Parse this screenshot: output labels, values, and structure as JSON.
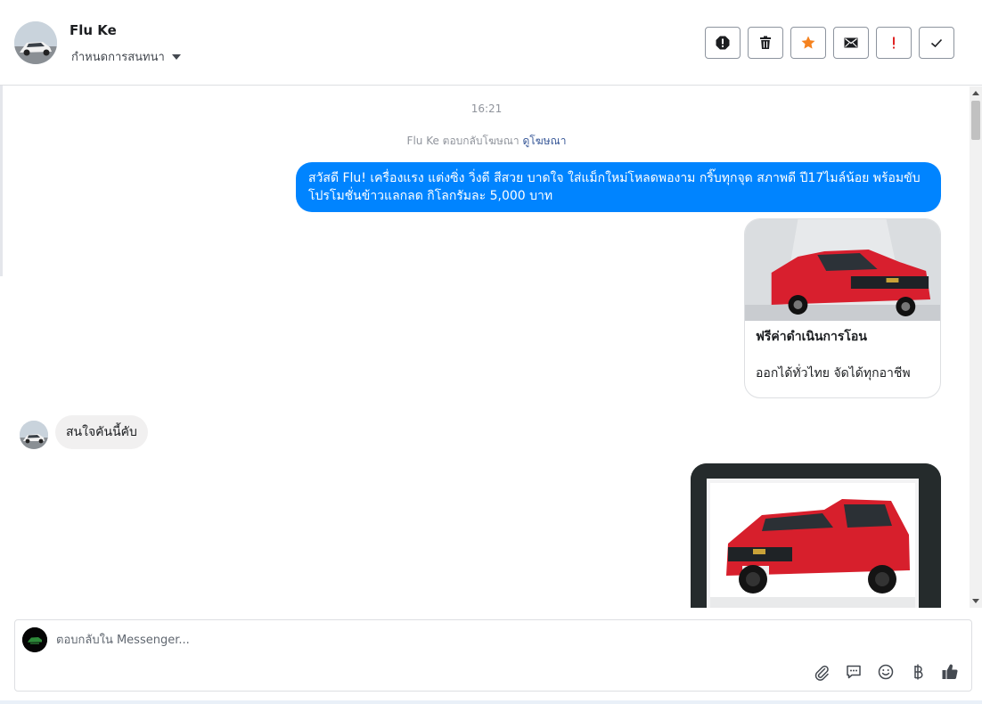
{
  "header": {
    "contact_name": "Flu Ke",
    "assign_label": "กำหนดการสนทนา"
  },
  "toolbar": {
    "buttons": [
      "spam-icon",
      "trash-icon",
      "star-icon",
      "mail-icon",
      "important-icon",
      "check-icon"
    ],
    "accent_colors": {
      "star": "#f5821f",
      "important": "#e02424"
    }
  },
  "conversation": {
    "timestamp": "16:21",
    "ad_reply_text": "Flu Ke ตอบกลับโฆษณา",
    "ad_reply_link": "ดูโฆษณา",
    "outgoing_message": "สวัสดี Flu! เครื่องแรง แต่งซิ่ง วิ่งดี สีสวย บาดใจ ใส่แม็กใหม่โหลดพองาม กริ๊บทุกจุด สภาพดี ปี17ไมล์น้อย พร้อมขับ โปรโมชั่นข้าวแลกลด กิโลกรัมละ 5,000 บาท",
    "card_title": "ฟรีค่าดำเนินการโอน",
    "card_description": "ออกได้ทั่วไทย จัดได้ทุกอาชีพ",
    "incoming_message": "สนใจคันนี้คับ"
  },
  "composer": {
    "placeholder": "ตอบกลับใน Messenger..."
  },
  "colors": {
    "outgoing_bubble": "#0084ff",
    "incoming_bubble": "#f1f0f0",
    "link": "#385898"
  }
}
